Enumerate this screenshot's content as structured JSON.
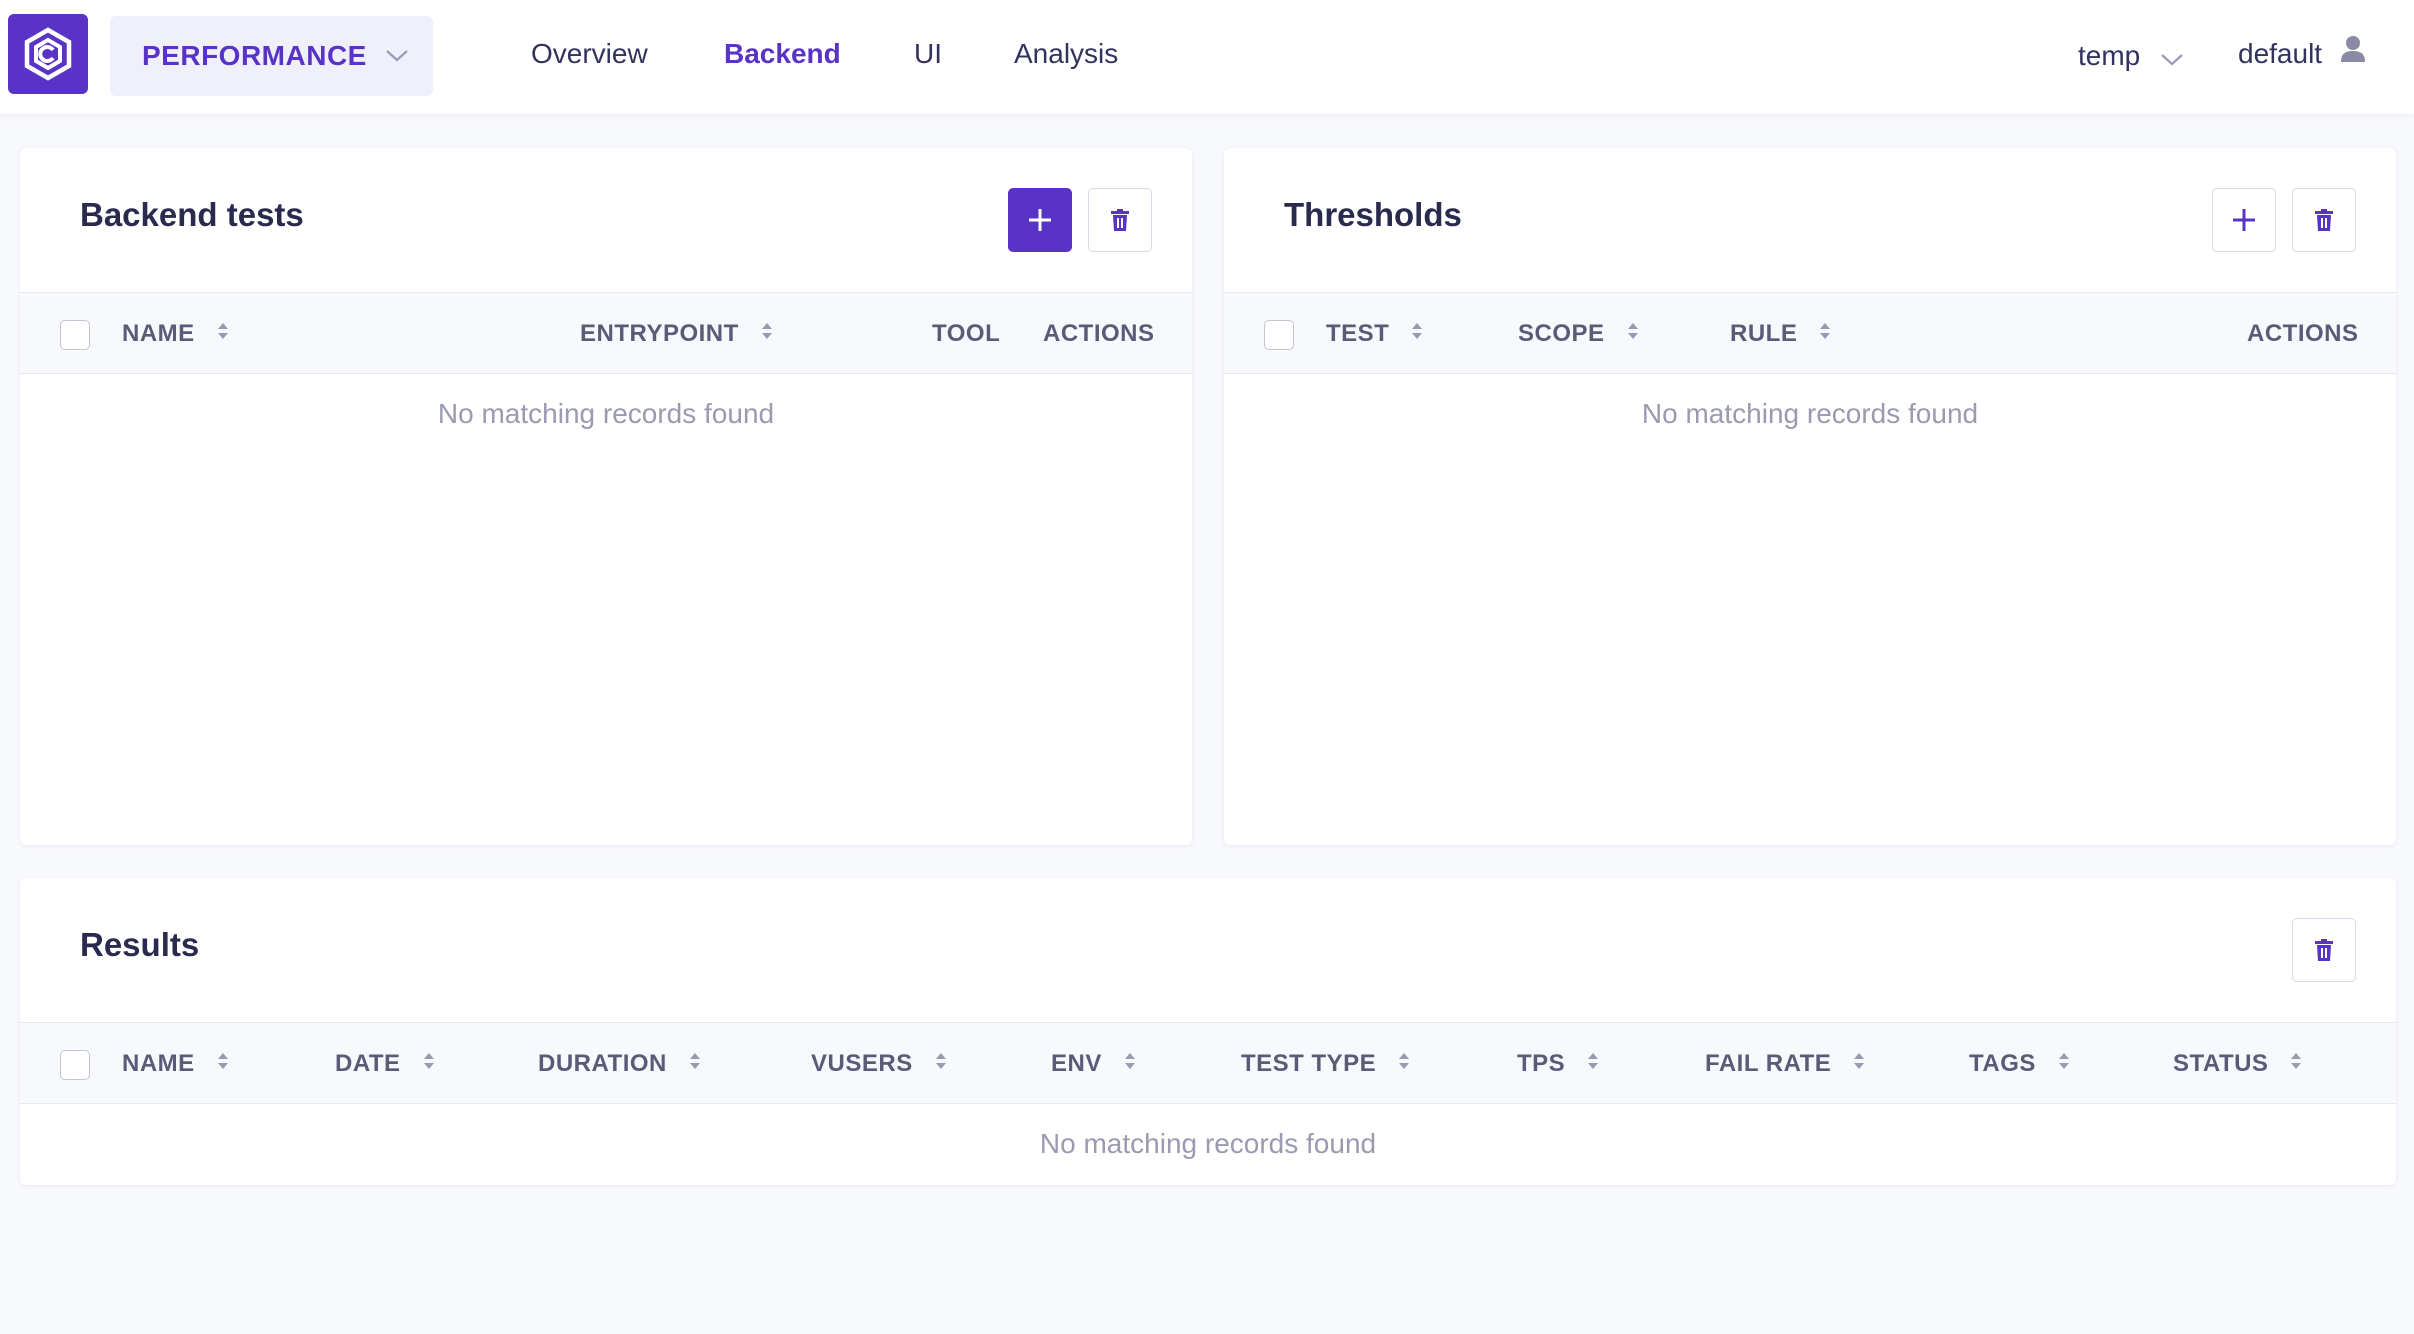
{
  "header": {
    "project": "PERFORMANCE",
    "nav": [
      "Overview",
      "Backend",
      "UI",
      "Analysis"
    ],
    "active_nav": "Backend",
    "environment": "temp",
    "user": "default"
  },
  "backend_tests": {
    "title": "Backend tests",
    "columns": [
      "NAME",
      "ENTRYPOINT",
      "TOOL",
      "ACTIONS"
    ],
    "empty_text": "No matching records found"
  },
  "thresholds": {
    "title": "Thresholds",
    "columns": [
      "TEST",
      "SCOPE",
      "RULE",
      "ACTIONS"
    ],
    "empty_text": "No matching records found"
  },
  "results": {
    "title": "Results",
    "columns": [
      "NAME",
      "DATE",
      "DURATION",
      "VUSERS",
      "ENV",
      "TEST TYPE",
      "TPS",
      "FAIL RATE",
      "TAGS",
      "STATUS"
    ],
    "empty_text": "No matching records found"
  },
  "colors": {
    "accent": "#5933c6",
    "background": "#f8f9fd",
    "muted_text": "#9a9ab0"
  },
  "icons": [
    "hexagon-logo-icon",
    "chevron-down-icon",
    "user-icon",
    "plus-icon",
    "trash-icon",
    "sort-icon"
  ]
}
